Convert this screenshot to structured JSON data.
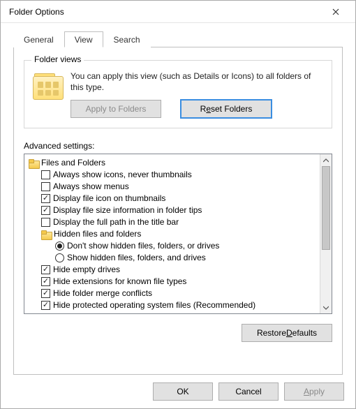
{
  "window": {
    "title": "Folder Options"
  },
  "tabs": {
    "general": "General",
    "view": "View",
    "search": "Search",
    "active": "view"
  },
  "folderViews": {
    "legend": "Folder views",
    "text": "You can apply this view (such as Details or Icons) to all folders of this type.",
    "applyLabel": "Apply to Folders",
    "resetPre": "R",
    "resetU": "e",
    "resetPost": "set Folders"
  },
  "advanced": {
    "label": "Advanced settings:",
    "items": [
      {
        "kind": "folder",
        "indent": 1,
        "label": "Files and Folders",
        "name": "node-files-and-folders"
      },
      {
        "kind": "check",
        "indent": 2,
        "checked": false,
        "label": "Always show icons, never thumbnails",
        "name": "opt-always-icons"
      },
      {
        "kind": "check",
        "indent": 2,
        "checked": false,
        "label": "Always show menus",
        "name": "opt-always-menus"
      },
      {
        "kind": "check",
        "indent": 2,
        "checked": true,
        "label": "Display file icon on thumbnails",
        "name": "opt-icon-on-thumb"
      },
      {
        "kind": "check",
        "indent": 2,
        "checked": true,
        "label": "Display file size information in folder tips",
        "name": "opt-file-size-tips"
      },
      {
        "kind": "check",
        "indent": 2,
        "checked": false,
        "label": "Display the full path in the title bar",
        "name": "opt-full-path-title"
      },
      {
        "kind": "folder",
        "indent": 2,
        "label": "Hidden files and folders",
        "name": "node-hidden-files"
      },
      {
        "kind": "radio",
        "indent": 3,
        "checked": true,
        "label": "Don't show hidden files, folders, or drives",
        "name": "opt-dont-show-hidden"
      },
      {
        "kind": "radio",
        "indent": 3,
        "checked": false,
        "label": "Show hidden files, folders, and drives",
        "name": "opt-show-hidden"
      },
      {
        "kind": "check",
        "indent": 2,
        "checked": true,
        "label": "Hide empty drives",
        "name": "opt-hide-empty-drives"
      },
      {
        "kind": "check",
        "indent": 2,
        "checked": true,
        "label": "Hide extensions for known file types",
        "name": "opt-hide-extensions"
      },
      {
        "kind": "check",
        "indent": 2,
        "checked": true,
        "label": "Hide folder merge conflicts",
        "name": "opt-hide-merge-conflicts"
      },
      {
        "kind": "check",
        "indent": 2,
        "checked": true,
        "label": "Hide protected operating system files (Recommended)",
        "name": "opt-hide-protected-os"
      }
    ]
  },
  "restore": {
    "pre": "Restore ",
    "u": "D",
    "post": "efaults"
  },
  "footer": {
    "ok": "OK",
    "cancel": "Cancel",
    "applyPre": "",
    "applyU": "A",
    "applyPost": "pply"
  }
}
